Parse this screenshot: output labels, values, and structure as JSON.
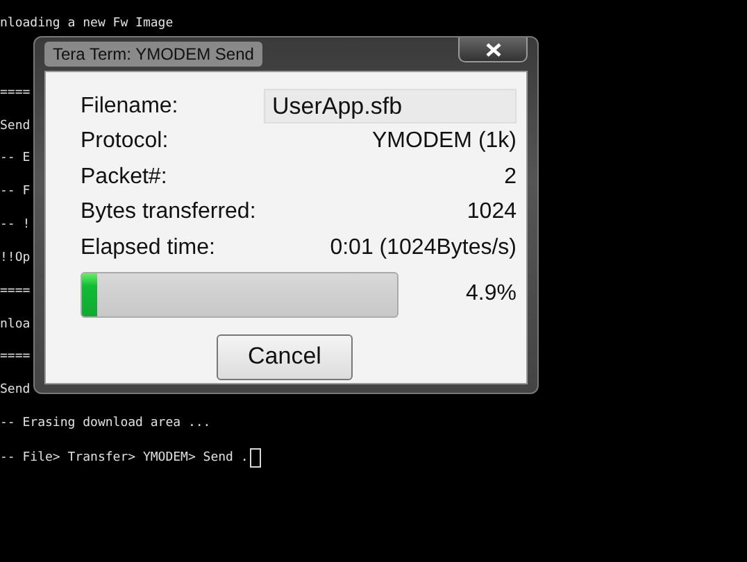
{
  "terminal": {
    "lines": [
      "nloading a new Fw Image",
      "====",
      "Send",
      "-- E",
      "-- F",
      "-- !",
      "!!Op",
      "====",
      "nloa",
      "====",
      "Send",
      "-- Erasing download area ...",
      "-- File> Transfer> YMODEM> Send ."
    ]
  },
  "dialog": {
    "title": "Tera Term: YMODEM Send",
    "filename_label": "Filename:",
    "filename": "UserApp.sfb",
    "rows": [
      {
        "label": "Protocol:",
        "value": "YMODEM (1k)"
      },
      {
        "label": "Packet#:",
        "value": "2"
      },
      {
        "label": "Bytes transferred:",
        "value": "1024"
      },
      {
        "label": "Elapsed time:",
        "value": "0:01 (1024Bytes/s)"
      }
    ],
    "progress": {
      "level": 0.049,
      "reading": "4.9%"
    },
    "buttons": [
      "Cancel"
    ]
  }
}
